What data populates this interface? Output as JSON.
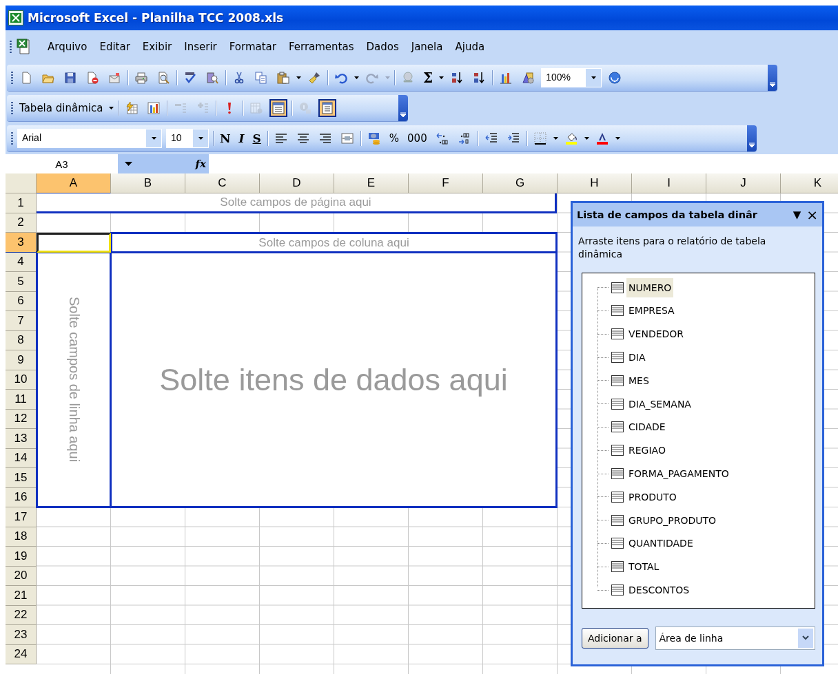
{
  "window": {
    "title": "Microsoft Excel - Planilha TCC 2008.xls"
  },
  "menu": [
    "Arquivo",
    "Editar",
    "Exibir",
    "Inserir",
    "Formatar",
    "Ferramentas",
    "Dados",
    "Janela",
    "Ajuda"
  ],
  "standard_toolbar": {
    "sum": "Σ",
    "zoom": "100%"
  },
  "pivot_toolbar": {
    "menu_label": "Tabela dinâmica",
    "buttons": [
      {
        "disabled": false,
        "pressed": false
      },
      {
        "disabled": false,
        "pressed": false
      },
      {
        "disabled": true,
        "pressed": false
      },
      {
        "disabled": true,
        "pressed": false
      },
      {
        "disabled": false,
        "pressed": false
      },
      {
        "disabled": true,
        "pressed": false
      },
      {
        "disabled": false,
        "pressed": true
      },
      {
        "disabled": true,
        "pressed": false
      },
      {
        "disabled": false,
        "pressed": true
      }
    ]
  },
  "formatting_toolbar": {
    "font": "Arial",
    "size": "10",
    "bold": "N",
    "italic": "I",
    "underline": "S",
    "percent": "%",
    "thousands": "000"
  },
  "formula_bar": {
    "name_box": "A3",
    "fx": "fx"
  },
  "sheet": {
    "columns": [
      {
        "label": "A",
        "selected": true
      },
      {
        "label": "B",
        "selected": false
      },
      {
        "label": "C",
        "selected": false
      },
      {
        "label": "D",
        "selected": false
      },
      {
        "label": "E",
        "selected": false
      },
      {
        "label": "F",
        "selected": false
      },
      {
        "label": "G",
        "selected": false
      },
      {
        "label": "H",
        "selected": false
      },
      {
        "label": "I",
        "selected": false
      },
      {
        "label": "J",
        "selected": false
      },
      {
        "label": "K",
        "selected": false
      }
    ],
    "rows": [
      {
        "label": "1",
        "selected": false
      },
      {
        "label": "2",
        "selected": false
      },
      {
        "label": "3",
        "selected": true
      },
      {
        "label": "4",
        "selected": false
      },
      {
        "label": "5",
        "selected": false
      },
      {
        "label": "6",
        "selected": false
      },
      {
        "label": "7",
        "selected": false
      },
      {
        "label": "8",
        "selected": false
      },
      {
        "label": "9",
        "selected": false
      },
      {
        "label": "10",
        "selected": false
      },
      {
        "label": "11",
        "selected": false
      },
      {
        "label": "12",
        "selected": false
      },
      {
        "label": "13",
        "selected": false
      },
      {
        "label": "14",
        "selected": false
      },
      {
        "label": "15",
        "selected": false
      },
      {
        "label": "16",
        "selected": false
      },
      {
        "label": "17",
        "selected": false
      },
      {
        "label": "18",
        "selected": false
      },
      {
        "label": "19",
        "selected": false
      },
      {
        "label": "20",
        "selected": false
      },
      {
        "label": "21",
        "selected": false
      },
      {
        "label": "22",
        "selected": false
      },
      {
        "label": "23",
        "selected": false
      },
      {
        "label": "24",
        "selected": false
      }
    ],
    "pivot": {
      "page_area": "Solte campos de página aqui",
      "column_area": "Solte campos de coluna aqui",
      "row_area": "Solte campos de linha aqui",
      "data_area": "Solte itens de dados aqui"
    }
  },
  "field_list": {
    "title": "Lista de campos da tabela dinâr",
    "menu_glyph": "▼",
    "close_glyph": "×",
    "instructions": "Arraste itens para o relatório de tabela dinâmica",
    "fields": [
      {
        "name": "NUMERO",
        "selected": true
      },
      {
        "name": "EMPRESA",
        "selected": false
      },
      {
        "name": "VENDEDOR",
        "selected": false
      },
      {
        "name": "DIA",
        "selected": false
      },
      {
        "name": "MES",
        "selected": false
      },
      {
        "name": "DIA_SEMANA",
        "selected": false
      },
      {
        "name": "CIDADE",
        "selected": false
      },
      {
        "name": "REGIAO",
        "selected": false
      },
      {
        "name": "FORMA_PAGAMENTO",
        "selected": false
      },
      {
        "name": "PRODUTO",
        "selected": false
      },
      {
        "name": "GRUPO_PRODUTO",
        "selected": false
      },
      {
        "name": "QUANTIDADE",
        "selected": false
      },
      {
        "name": "TOTAL",
        "selected": false
      },
      {
        "name": "DESCONTOS",
        "selected": false
      }
    ],
    "add_button": "Adicionar a",
    "area": "Área de linha"
  }
}
